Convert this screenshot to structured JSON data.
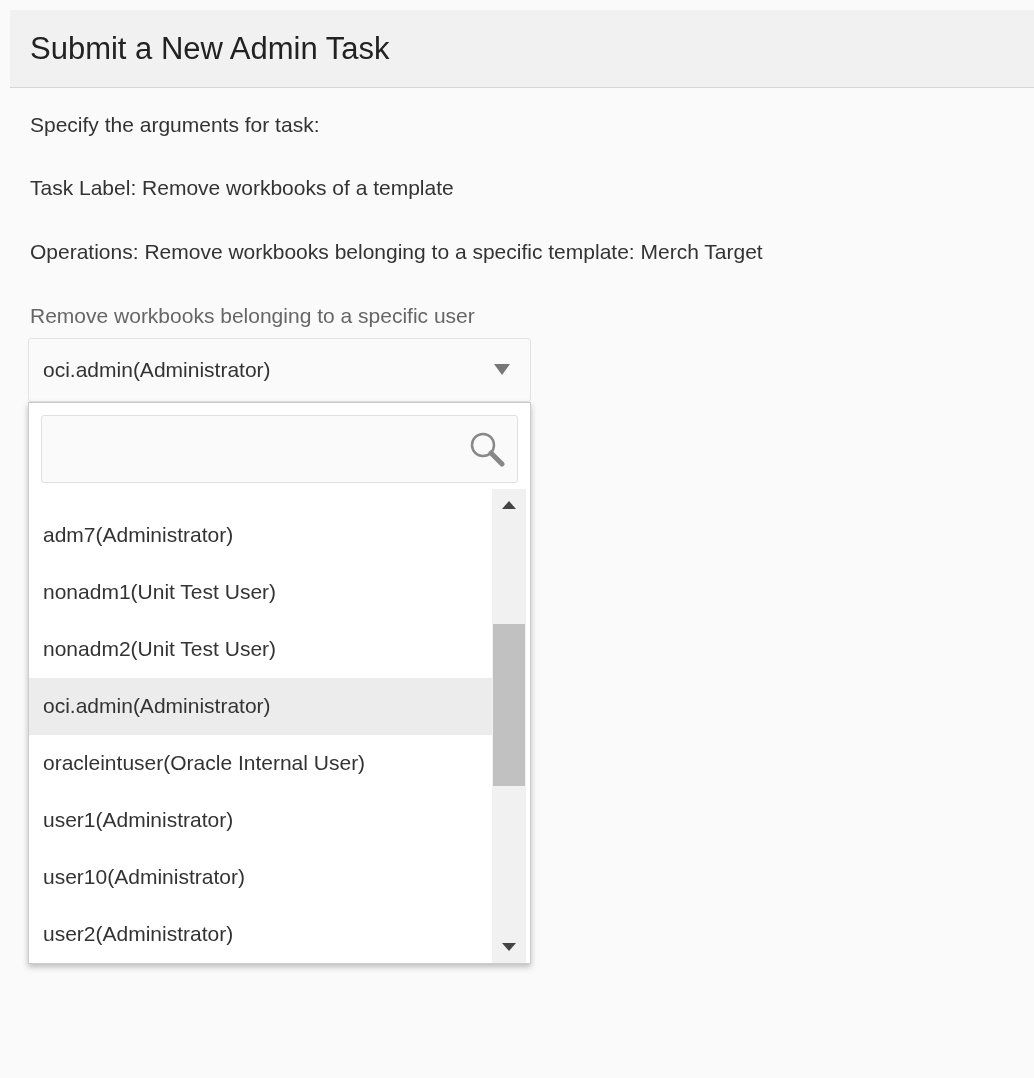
{
  "header": {
    "title": "Submit a New Admin Task"
  },
  "paragraphs": [
    "Specify the arguments for task:",
    "Task Label: Remove workbooks of a template",
    "Operations: Remove workbooks belonging to a specific template: Merch Target"
  ],
  "field": {
    "label": "Remove workbooks belonging to a specific user",
    "value": "oci.admin(Administrator)",
    "expanded": true
  },
  "dropdown": {
    "items": [
      {
        "label": "adm7(Administrator)",
        "selected": false
      },
      {
        "label": "nonadm1(Unit Test User)",
        "selected": false
      },
      {
        "label": "nonadm2(Unit Test User)",
        "selected": false
      },
      {
        "label": "oci.admin(Administrator)",
        "selected": true
      },
      {
        "label": "oracleintuser(Oracle Internal User)",
        "selected": false
      },
      {
        "label": "user1(Administrator)",
        "selected": false
      },
      {
        "label": "user10(Administrator)",
        "selected": false
      },
      {
        "label": "user2(Administrator)",
        "selected": false
      }
    ]
  }
}
